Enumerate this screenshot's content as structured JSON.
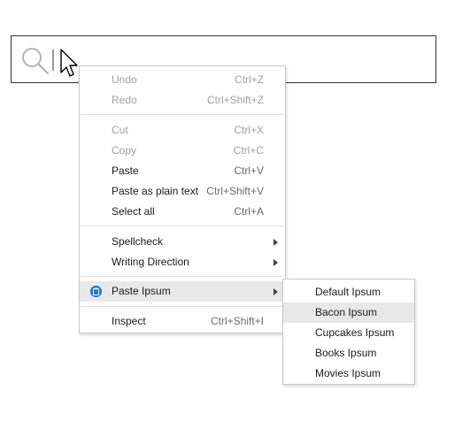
{
  "context_menu": {
    "items": [
      {
        "label": "Undo",
        "shortcut": "Ctrl+Z"
      },
      {
        "label": "Redo",
        "shortcut": "Ctrl+Shift+Z"
      },
      {
        "label": "Cut",
        "shortcut": "Ctrl+X"
      },
      {
        "label": "Copy",
        "shortcut": "Ctrl+C"
      },
      {
        "label": "Paste",
        "shortcut": "Ctrl+V"
      },
      {
        "label": "Paste as plain text",
        "shortcut": "Ctrl+Shift+V"
      },
      {
        "label": "Select all",
        "shortcut": "Ctrl+A"
      },
      {
        "label": "Spellcheck"
      },
      {
        "label": "Writing Direction"
      },
      {
        "label": "Paste Ipsum"
      },
      {
        "label": "Inspect",
        "shortcut": "Ctrl+Shift+I"
      }
    ]
  },
  "submenu": {
    "items": [
      {
        "label": "Default Ipsum"
      },
      {
        "label": "Bacon Ipsum"
      },
      {
        "label": "Cupcakes Ipsum"
      },
      {
        "label": "Books Ipsum"
      },
      {
        "label": "Movies Ipsum"
      }
    ]
  },
  "colors": {
    "accent": "#1a73e8",
    "highlight": "#e8e8e8",
    "disabled_text": "#a0a0a0"
  },
  "icons": {
    "search": "search-icon",
    "cursor": "mouse-pointer-icon",
    "extension": "clipboard-icon",
    "submenu_arrow": "chevron-right-icon"
  }
}
